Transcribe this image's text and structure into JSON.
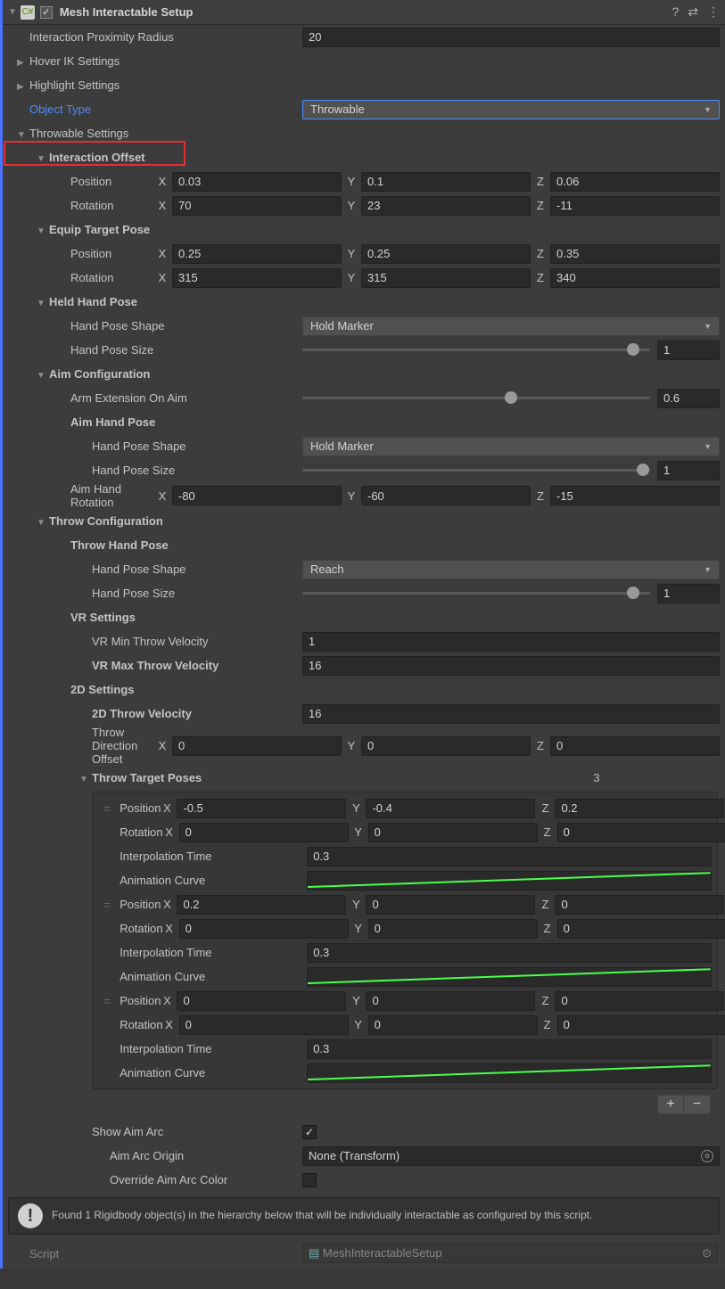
{
  "header": {
    "title": "Mesh Interactable Setup"
  },
  "interactionProximityRadius": {
    "label": "Interaction Proximity Radius",
    "value": "20"
  },
  "hoverIK": {
    "label": "Hover IK Settings"
  },
  "highlight": {
    "label": "Highlight Settings"
  },
  "objectType": {
    "label": "Object Type",
    "value": "Throwable"
  },
  "throwableSettings": {
    "label": "Throwable Settings"
  },
  "interactionOffset": {
    "label": "Interaction Offset",
    "position": {
      "label": "Position",
      "x": "0.03",
      "y": "0.1",
      "z": "0.06"
    },
    "rotation": {
      "label": "Rotation",
      "x": "70",
      "y": "23",
      "z": "-11"
    }
  },
  "equipTargetPose": {
    "label": "Equip Target Pose",
    "position": {
      "label": "Position",
      "x": "0.25",
      "y": "0.25",
      "z": "0.35"
    },
    "rotation": {
      "label": "Rotation",
      "x": "315",
      "y": "315",
      "z": "340"
    }
  },
  "heldHandPose": {
    "label": "Held Hand Pose",
    "shape": {
      "label": "Hand Pose Shape",
      "value": "Hold Marker"
    },
    "size": {
      "label": "Hand Pose Size",
      "value": "1",
      "pos": 95
    }
  },
  "aimConfig": {
    "label": "Aim Configuration",
    "armExtension": {
      "label": "Arm Extension On Aim",
      "value": "0.6",
      "pos": 60
    },
    "aimHandPose": {
      "label": "Aim Hand Pose"
    },
    "shape": {
      "label": "Hand Pose Shape",
      "value": "Hold Marker"
    },
    "size": {
      "label": "Hand Pose Size",
      "value": "1",
      "pos": 98
    },
    "aimHandRotation": {
      "label": "Aim Hand Rotation",
      "x": "-80",
      "y": "-60",
      "z": "-15"
    }
  },
  "throwConfig": {
    "label": "Throw Configuration",
    "throwHandPose": {
      "label": "Throw Hand Pose"
    },
    "shape": {
      "label": "Hand Pose Shape",
      "value": "Reach"
    },
    "size": {
      "label": "Hand Pose Size",
      "value": "1",
      "pos": 95
    },
    "vrSettings": {
      "label": "VR Settings"
    },
    "vrMin": {
      "label": "VR Min Throw Velocity",
      "value": "1"
    },
    "vrMax": {
      "label": "VR Max Throw Velocity",
      "value": "16"
    },
    "d2Settings": {
      "label": "2D Settings"
    },
    "d2Velocity": {
      "label": "2D Throw Velocity",
      "value": "16"
    },
    "throwDirOffset": {
      "label": "Throw Direction Offset",
      "x": "0",
      "y": "0",
      "z": "0"
    },
    "throwTargetPoses": {
      "label": "Throw Target Poses",
      "count": "3"
    },
    "poses": [
      {
        "position": {
          "x": "-0.5",
          "y": "-0.4",
          "z": "0.2"
        },
        "rotation": {
          "x": "0",
          "y": "0",
          "z": "0"
        },
        "interp": "0.3"
      },
      {
        "position": {
          "x": "0.2",
          "y": "0",
          "z": "0"
        },
        "rotation": {
          "x": "0",
          "y": "0",
          "z": "0"
        },
        "interp": "0.3"
      },
      {
        "position": {
          "x": "0",
          "y": "0",
          "z": "0"
        },
        "rotation": {
          "x": "0",
          "y": "0",
          "z": "0"
        },
        "interp": "0.3"
      }
    ],
    "poseLabels": {
      "position": "Position",
      "rotation": "Rotation",
      "interp": "Interpolation Time",
      "curve": "Animation Curve"
    },
    "showAimArc": {
      "label": "Show Aim Arc",
      "checked": true
    },
    "aimArcOrigin": {
      "label": "Aim Arc Origin",
      "value": "None (Transform)"
    },
    "overrideAimArcColor": {
      "label": "Override Aim Arc Color",
      "checked": false
    }
  },
  "infoBox": {
    "text": "Found 1 Rigidbody object(s) in the hierarchy below that will be individually interactable as configured by this script."
  },
  "script": {
    "label": "Script",
    "value": "MeshInteractableSetup"
  },
  "axisLabels": {
    "x": "X",
    "y": "Y",
    "z": "Z"
  }
}
